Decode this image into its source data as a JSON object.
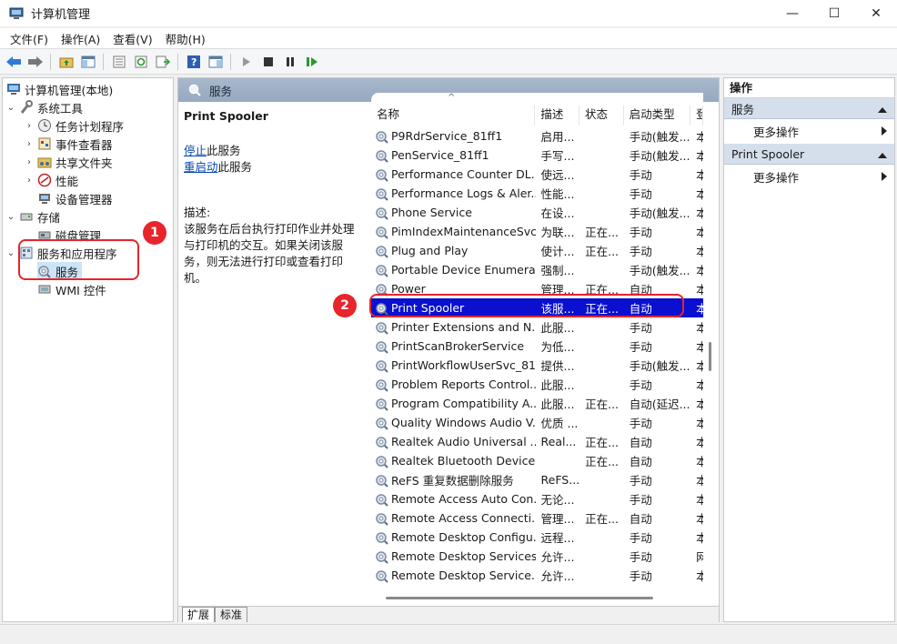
{
  "window": {
    "title": "计算机管理",
    "minimize": "—",
    "maximize": "☐",
    "close": "✕"
  },
  "menu": [
    "文件(F)",
    "操作(A)",
    "查看(V)",
    "帮助(H)"
  ],
  "tree": {
    "root": "计算机管理(本地)",
    "system_tools": "系统工具",
    "task_scheduler": "任务计划程序",
    "event_viewer": "事件查看器",
    "shared_folders": "共享文件夹",
    "performance": "性能",
    "device_manager": "设备管理器",
    "storage": "存储",
    "disk_management": "磁盘管理",
    "services_apps": "服务和应用程序",
    "services": "服务",
    "wmi": "WMI 控件"
  },
  "header": {
    "title": "服务"
  },
  "detail": {
    "service_name": "Print Spooler",
    "stop_link": "停止",
    "stop_suffix": "此服务",
    "restart_link": "重启动",
    "restart_suffix": "此服务",
    "desc_label": "描述:",
    "desc_text": "该服务在后台执行打印作业并处理与打印机的交互。如果关闭该服务，则无法进行打印或查看打印机。"
  },
  "columns": {
    "name": "名称",
    "desc": "描述",
    "status": "状态",
    "startup": "启动类型",
    "logon": "登"
  },
  "rows": [
    {
      "name": "P9RdrService_81ff1",
      "desc": "启用...",
      "status": "",
      "startup": "手动(触发...",
      "logon": "本"
    },
    {
      "name": "PenService_81ff1",
      "desc": "手写...",
      "status": "",
      "startup": "手动(触发...",
      "logon": "本"
    },
    {
      "name": "Performance Counter DL...",
      "desc": "使远...",
      "status": "",
      "startup": "手动",
      "logon": "本"
    },
    {
      "name": "Performance Logs & Aler...",
      "desc": "性能...",
      "status": "",
      "startup": "手动",
      "logon": "本"
    },
    {
      "name": "Phone Service",
      "desc": "在设...",
      "status": "",
      "startup": "手动(触发...",
      "logon": "本"
    },
    {
      "name": "PimIndexMaintenanceSvc...",
      "desc": "为联...",
      "status": "正在...",
      "startup": "手动",
      "logon": "本"
    },
    {
      "name": "Plug and Play",
      "desc": "使计...",
      "status": "正在...",
      "startup": "手动",
      "logon": "本"
    },
    {
      "name": "Portable Device Enumera...",
      "desc": "强制...",
      "status": "",
      "startup": "手动(触发...",
      "logon": "本"
    },
    {
      "name": "Power",
      "desc": "管理...",
      "status": "正在...",
      "startup": "自动",
      "logon": "本"
    },
    {
      "name": "Print Spooler",
      "desc": "该服...",
      "status": "正在...",
      "startup": "自动",
      "logon": "本",
      "selected": true
    },
    {
      "name": "Printer Extensions and N...",
      "desc": "此服...",
      "status": "",
      "startup": "手动",
      "logon": "本"
    },
    {
      "name": "PrintScanBrokerService",
      "desc": "为低...",
      "status": "",
      "startup": "手动",
      "logon": "本"
    },
    {
      "name": "PrintWorkflowUserSvc_81...",
      "desc": "提供...",
      "status": "",
      "startup": "手动(触发...",
      "logon": "本"
    },
    {
      "name": "Problem Reports Control...",
      "desc": "此服...",
      "status": "",
      "startup": "手动",
      "logon": "本"
    },
    {
      "name": "Program Compatibility A...",
      "desc": "此服...",
      "status": "正在...",
      "startup": "自动(延迟...",
      "logon": "本"
    },
    {
      "name": "Quality Windows Audio V...",
      "desc": "优质 ...",
      "status": "",
      "startup": "手动",
      "logon": "本"
    },
    {
      "name": "Realtek Audio Universal ...",
      "desc": "Real...",
      "status": "正在...",
      "startup": "自动",
      "logon": "本"
    },
    {
      "name": "Realtek Bluetooth Device...",
      "desc": "",
      "status": "正在...",
      "startup": "自动",
      "logon": "本"
    },
    {
      "name": "ReFS 重复数据删除服务",
      "desc": "ReFS...",
      "status": "",
      "startup": "手动",
      "logon": "本"
    },
    {
      "name": "Remote Access Auto Con...",
      "desc": "无论...",
      "status": "",
      "startup": "手动",
      "logon": "本"
    },
    {
      "name": "Remote Access Connecti...",
      "desc": "管理...",
      "status": "正在...",
      "startup": "自动",
      "logon": "本"
    },
    {
      "name": "Remote Desktop Configu...",
      "desc": "远程...",
      "status": "",
      "startup": "手动",
      "logon": "本"
    },
    {
      "name": "Remote Desktop Services",
      "desc": "允许...",
      "status": "",
      "startup": "手动",
      "logon": "网"
    },
    {
      "name": "Remote Desktop Service...",
      "desc": "允许...",
      "status": "",
      "startup": "手动",
      "logon": "本"
    }
  ],
  "tabs": [
    "扩展",
    "标准"
  ],
  "actions": {
    "title": "操作",
    "section1": "服务",
    "more1": "更多操作",
    "section2": "Print Spooler",
    "more2": "更多操作"
  },
  "annotations": {
    "badge1": "1",
    "badge2": "2"
  },
  "colors": {
    "highlight": "#e8242c",
    "selection": "#0a0fd0"
  }
}
